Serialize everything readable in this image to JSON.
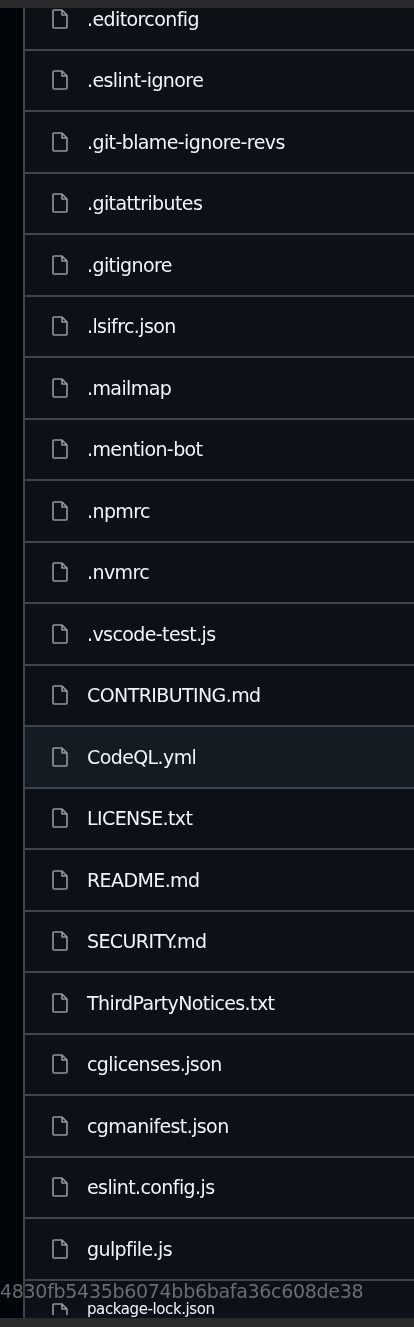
{
  "files": [
    {
      "name": ".editorconfig",
      "selected": false
    },
    {
      "name": ".eslint-ignore",
      "selected": false
    },
    {
      "name": ".git-blame-ignore-revs",
      "selected": false
    },
    {
      "name": ".gitattributes",
      "selected": false
    },
    {
      "name": ".gitignore",
      "selected": false
    },
    {
      "name": ".lsifrc.json",
      "selected": false
    },
    {
      "name": ".mailmap",
      "selected": false
    },
    {
      "name": ".mention-bot",
      "selected": false
    },
    {
      "name": ".npmrc",
      "selected": false
    },
    {
      "name": ".nvmrc",
      "selected": false
    },
    {
      "name": ".vscode-test.js",
      "selected": false
    },
    {
      "name": "CONTRIBUTING.md",
      "selected": false
    },
    {
      "name": "CodeQL.yml",
      "selected": true
    },
    {
      "name": "LICENSE.txt",
      "selected": false
    },
    {
      "name": "README.md",
      "selected": false
    },
    {
      "name": "SECURITY.md",
      "selected": false
    },
    {
      "name": "ThirdPartyNotices.txt",
      "selected": false
    },
    {
      "name": "cglicenses.json",
      "selected": false
    },
    {
      "name": "cgmanifest.json",
      "selected": false
    },
    {
      "name": "eslint.config.js",
      "selected": false
    },
    {
      "name": "gulpfile.js",
      "selected": false
    },
    {
      "name": "package-lock.json",
      "selected": false
    }
  ],
  "commit_hash": "4830fb5435b6074bb6bafa36c608de38"
}
